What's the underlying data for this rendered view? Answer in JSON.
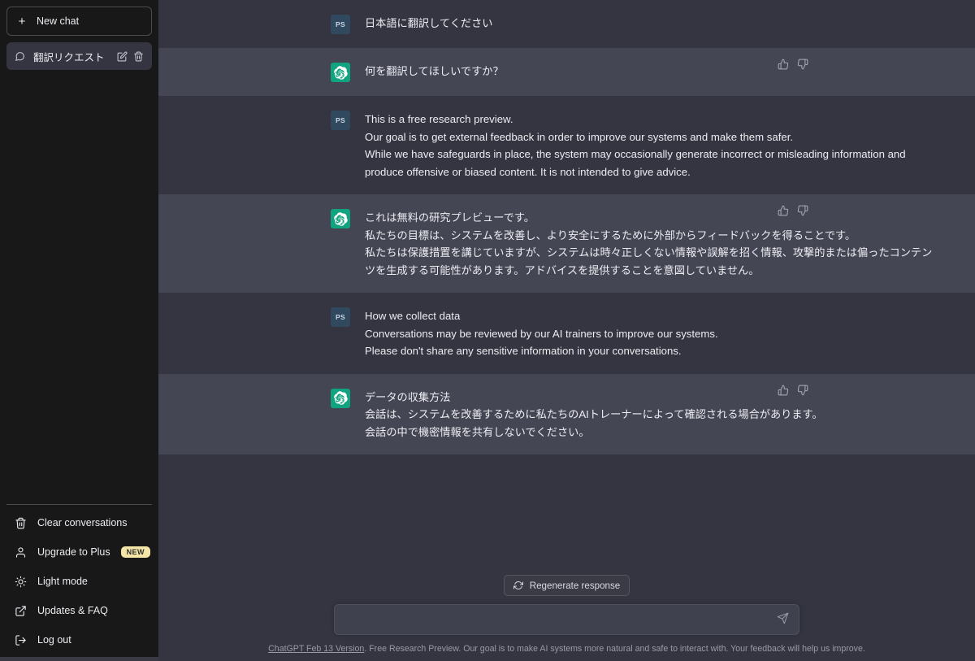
{
  "sidebar": {
    "new_chat_label": "New chat",
    "conversation": {
      "title": "翻訳リクエスト",
      "edit_title": "Edit",
      "delete_title": "Delete"
    },
    "nav_items": [
      {
        "label": "Clear conversations",
        "icon": "trash-icon",
        "badge": ""
      },
      {
        "label": "Upgrade to Plus",
        "icon": "person-icon",
        "badge": "NEW"
      },
      {
        "label": "Light mode",
        "icon": "sun-icon",
        "badge": ""
      },
      {
        "label": "Updates & FAQ",
        "icon": "external-link-icon",
        "badge": ""
      },
      {
        "label": "Log out",
        "icon": "logout-icon",
        "badge": ""
      }
    ]
  },
  "conversation": {
    "messages": [
      {
        "role": "user",
        "avatar_initials": "PS",
        "lines": [
          "日本語に翻訳してください"
        ]
      },
      {
        "role": "assistant",
        "lines": [
          "何を翻訳してほしいですか？"
        ]
      },
      {
        "role": "user",
        "avatar_initials": "PS",
        "lines": [
          "This is a free research preview.",
          "Our goal is to get external feedback in order to improve our systems and make them safer.",
          "While we have safeguards in place, the system may occasionally generate incorrect or misleading information and produce offensive or biased content. It is not intended to give advice."
        ]
      },
      {
        "role": "assistant",
        "lines": [
          "これは無料の研究プレビューです。",
          "私たちの目標は、システムを改善し、より安全にするために外部からフィードバックを得ることです。",
          "私たちは保護措置を講じていますが、システムは時々正しくない情報や誤解を招く情報、攻撃的または偏ったコンテンツを生成する可能性があります。アドバイスを提供することを意図していません。"
        ]
      },
      {
        "role": "user",
        "avatar_initials": "PS",
        "lines": [
          "How we collect data",
          "Conversations may be reviewed by our AI trainers to improve our systems.",
          "Please don't share any sensitive information in your conversations."
        ]
      },
      {
        "role": "assistant",
        "lines": [
          "データの収集方法",
          "会話は、システムを改善するために私たちのAIトレーナーによって確認される場合があります。",
          "会話の中で機密情報を共有しないでください。"
        ]
      }
    ]
  },
  "composer": {
    "regenerate_label": "Regenerate response",
    "input_value": "",
    "input_placeholder": "",
    "send_title": "Send message"
  },
  "footer": {
    "link_text": "ChatGPT Feb 13 Version",
    "rest_text": ". Free Research Preview. Our goal is to make AI systems more natural and safe to interact with. Your feedback will help us improve."
  },
  "colors": {
    "sidebar_bg": "#181818",
    "user_msg_bg": "#343541",
    "bot_msg_bg": "#444654",
    "accent_green": "#10a37f",
    "badge_yellow": "#f5e6a8",
    "user_avatar_blue": "#31495e"
  }
}
